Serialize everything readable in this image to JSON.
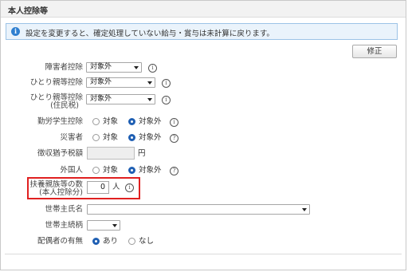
{
  "header": {
    "title": "本人控除等"
  },
  "info": {
    "message": "設定を変更すると、確定処理していない給与・賞与は未計算に戻ります。"
  },
  "toolbar": {
    "edit_label": "修正"
  },
  "fields": {
    "disability": {
      "label": "障害者控除",
      "value": "対象外"
    },
    "single_parent": {
      "label": "ひとり親等控除",
      "value": "対象外"
    },
    "single_parent_resident": {
      "label_line1": "ひとり親等控除",
      "label_line2": "(住民税)",
      "value": "対象外"
    },
    "working_student": {
      "label": "勤労学生控除",
      "option1": "対象",
      "option2": "対象外",
      "selected": "対象外"
    },
    "disaster": {
      "label": "災害者",
      "option1": "対象",
      "option2": "対象外",
      "selected": "対象外"
    },
    "tax_deferral": {
      "label": "徴収猶予税額",
      "value": "",
      "unit": "円"
    },
    "foreigner": {
      "label": "外国人",
      "option1": "対象",
      "option2": "対象外",
      "selected": "対象外"
    },
    "dependents": {
      "label_line1": "扶養親族等の数",
      "label_line2": "(本人控除分)",
      "value": "0",
      "unit": "人"
    },
    "household_head_name": {
      "label": "世帯主氏名",
      "value": ""
    },
    "household_head_relation": {
      "label": "世帯主続柄",
      "value": ""
    },
    "spouse": {
      "label": "配偶者の有無",
      "option1": "あり",
      "option2": "なし",
      "selected": "あり"
    }
  },
  "icons": {
    "info": "info-icon",
    "help": "question-circle-icon"
  },
  "colors": {
    "accent": "#1f5fb3",
    "highlight": "#e02020",
    "info_bg": "#eaf3fb"
  }
}
